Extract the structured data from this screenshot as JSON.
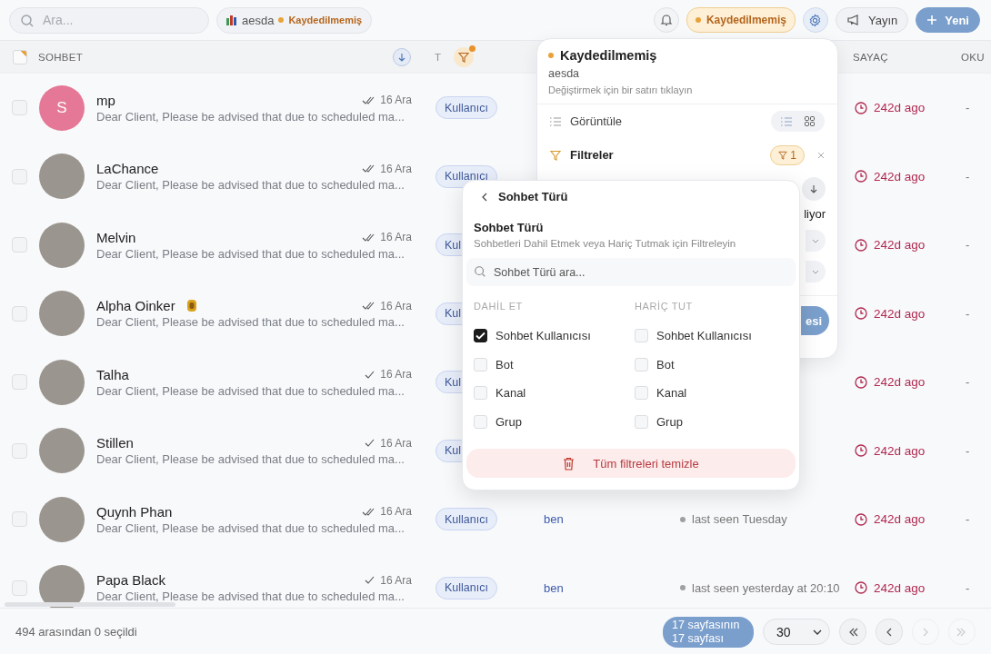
{
  "topbar": {
    "search": {
      "placeholder": "Ara..."
    },
    "view_chip": {
      "name": "aesda",
      "status": "Kaydedilmemiş"
    },
    "status": "Kaydedilmemiş",
    "broadcast": "Yayın",
    "new": "Yeni"
  },
  "table": {
    "select_all": {
      "partial": true
    },
    "headers": {
      "chat": "SOHBET",
      "type": "T",
      "counter": "SAYAÇ",
      "read": "OKU"
    },
    "type_filter_active": true,
    "rows": [
      {
        "name": "mp",
        "avatar": {
          "kind": "letter",
          "letter": "S",
          "color": "#e57896"
        },
        "checked": false,
        "read": true,
        "date": "16 Ara",
        "preview": "Dear Client, Please be advised that due to scheduled ma...",
        "type": "Kullanıcı",
        "counter": "242d ago",
        "read_count": "-"
      },
      {
        "name": "LaChance",
        "avatar": {
          "kind": "photo"
        },
        "checked": false,
        "read": true,
        "date": "16 Ara",
        "preview": "Dear Client, Please be advised that due to scheduled ma...",
        "type": "Kullanıcı",
        "counter": "242d ago",
        "read_count": "-"
      },
      {
        "name": "Melvin",
        "avatar": {
          "kind": "photo"
        },
        "checked": false,
        "read": true,
        "date": "16 Ara",
        "preview": "Dear Client, Please be advised that due to scheduled ma...",
        "type": "Kul",
        "counter": "242d ago",
        "read_count": "-"
      },
      {
        "name": "Alpha Oinker",
        "avatar": {
          "kind": "photo"
        },
        "emoji": true,
        "checked": false,
        "read": true,
        "date": "16 Ara",
        "preview": "Dear Client, Please be advised that due to scheduled ma...",
        "type": "Kul",
        "counter": "242d ago",
        "read_count": "-"
      },
      {
        "name": "Talha",
        "avatar": {
          "kind": "photo"
        },
        "checked": false,
        "read": false,
        "date": "16 Ara",
        "preview": "Dear Client, Please be advised that due to scheduled ma...",
        "type": "Kul",
        "counter": "242d ago",
        "read_count": "-"
      },
      {
        "name": "Stillen",
        "avatar": {
          "kind": "photo"
        },
        "checked": false,
        "read": false,
        "date": "16 Ara",
        "preview": "Dear Client, Please be advised that due to scheduled ma...",
        "type": "Kul",
        "counter": "242d ago",
        "read_count": "-"
      },
      {
        "name": "Quynh Phan",
        "avatar": {
          "kind": "photo"
        },
        "checked": false,
        "read": true,
        "date": "16 Ara",
        "preview": "Dear Client, Please be advised that due to scheduled ma...",
        "type": "Kullanıcı",
        "assigned": "ben",
        "last_seen": "last seen Tuesday",
        "counter": "242d ago",
        "read_count": "-"
      },
      {
        "name": "Papa Black",
        "avatar": {
          "kind": "photo"
        },
        "checked": false,
        "read": false,
        "date": "16 Ara",
        "preview": "Dear Client, Please be advised that due to scheduled ma...",
        "type": "Kullanıcı",
        "assigned": "ben",
        "last_seen": "last seen yesterday at 20:10",
        "counter": "242d ago",
        "read_count": "-"
      }
    ]
  },
  "view_panel": {
    "status": "Kaydedilmemiş",
    "view_name": "aesda",
    "hint": "Değiştirmek için bir satırı tıklayın",
    "display_label": "Görüntüle",
    "view_modes": [
      {
        "kind": "list",
        "selected": true
      },
      {
        "kind": "grid",
        "selected": false
      }
    ],
    "filters_label": "Filtreler",
    "filter_count": "1",
    "covered_text": "liyor",
    "covered_button": "esi"
  },
  "filter_panel": {
    "back_title": "Sohbet Türü",
    "title": "Sohbet Türü",
    "description": "Sohbetleri Dahil Etmek veya Hariç Tutmak için Filtreleyin",
    "search_placeholder": "Sohbet Türü ara...",
    "groups": [
      {
        "heading": "DAHİL ET",
        "options": [
          {
            "label": "Sohbet Kullanıcısı",
            "checked": true
          },
          {
            "label": "Bot",
            "checked": false
          },
          {
            "label": "Kanal",
            "checked": false
          },
          {
            "label": "Grup",
            "checked": false
          }
        ]
      },
      {
        "heading": "HARİÇ TUT",
        "options": [
          {
            "label": "Sohbet Kullanıcısı",
            "checked": false
          },
          {
            "label": "Bot",
            "checked": false
          },
          {
            "label": "Kanal",
            "checked": false
          },
          {
            "label": "Grup",
            "checked": false
          }
        ]
      }
    ],
    "clear": "Tüm filtreleri temizle"
  },
  "footer": {
    "selection": "494 arasından 0 seçildi",
    "page": "17 sayfasının 17 sayfası",
    "page_size": "30",
    "nav": [
      {
        "kind": "first",
        "disabled": false
      },
      {
        "kind": "prev",
        "disabled": false
      },
      {
        "kind": "next",
        "disabled": true
      },
      {
        "kind": "last",
        "disabled": true
      }
    ]
  }
}
